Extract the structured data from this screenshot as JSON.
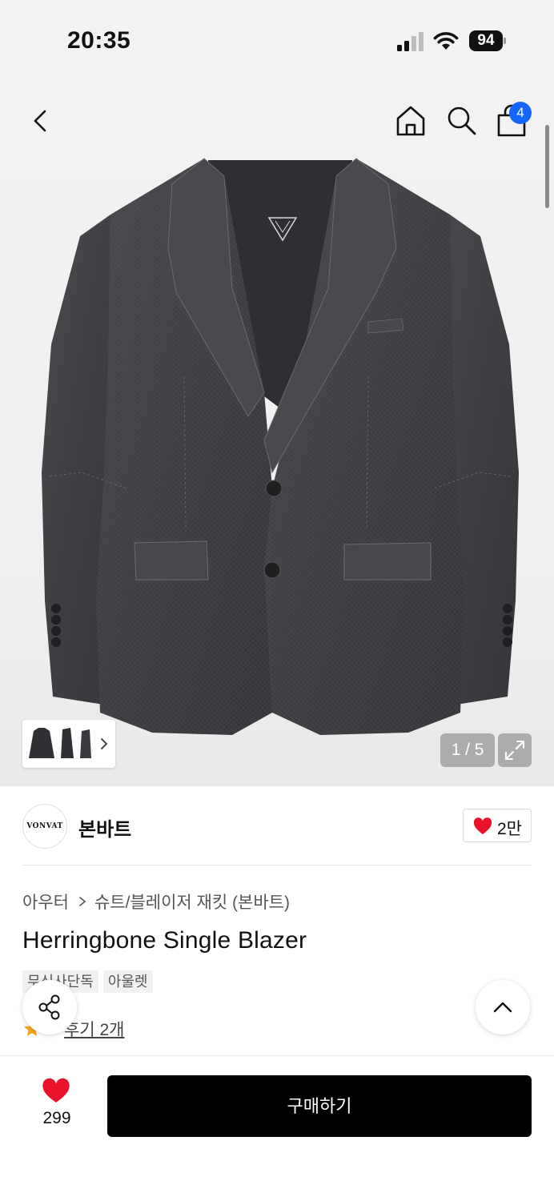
{
  "status_bar": {
    "time": "20:35",
    "battery": "94"
  },
  "nav": {
    "icons": [
      "back-arrow-icon",
      "home-icon",
      "search-icon",
      "shopping-bag-icon"
    ],
    "cart_count": "4"
  },
  "gallery": {
    "counter": "1 / 5",
    "image": "charcoal herringbone single-breasted blazer on white background",
    "thumbnails": [
      "blazer-front",
      "blazer-side",
      "blazer-back"
    ]
  },
  "brand": {
    "logo_text": "VONVAT",
    "name": "본바트",
    "likes": "2만"
  },
  "breadcrumb": {
    "level1": "아우터",
    "level2": "슈트/블레이저 재킷 (본바트)"
  },
  "product": {
    "title": "Herringbone Single Blazer",
    "tags": [
      "무신사단독",
      "아울렛"
    ],
    "reviews": "후기 2개"
  },
  "bottom_bar": {
    "wish_count": "299",
    "buy_label": "구매하기"
  },
  "colors": {
    "badge": "#1565ff",
    "heart": "#e8132b",
    "star": "#f5a623",
    "buy_button": "#000000"
  }
}
